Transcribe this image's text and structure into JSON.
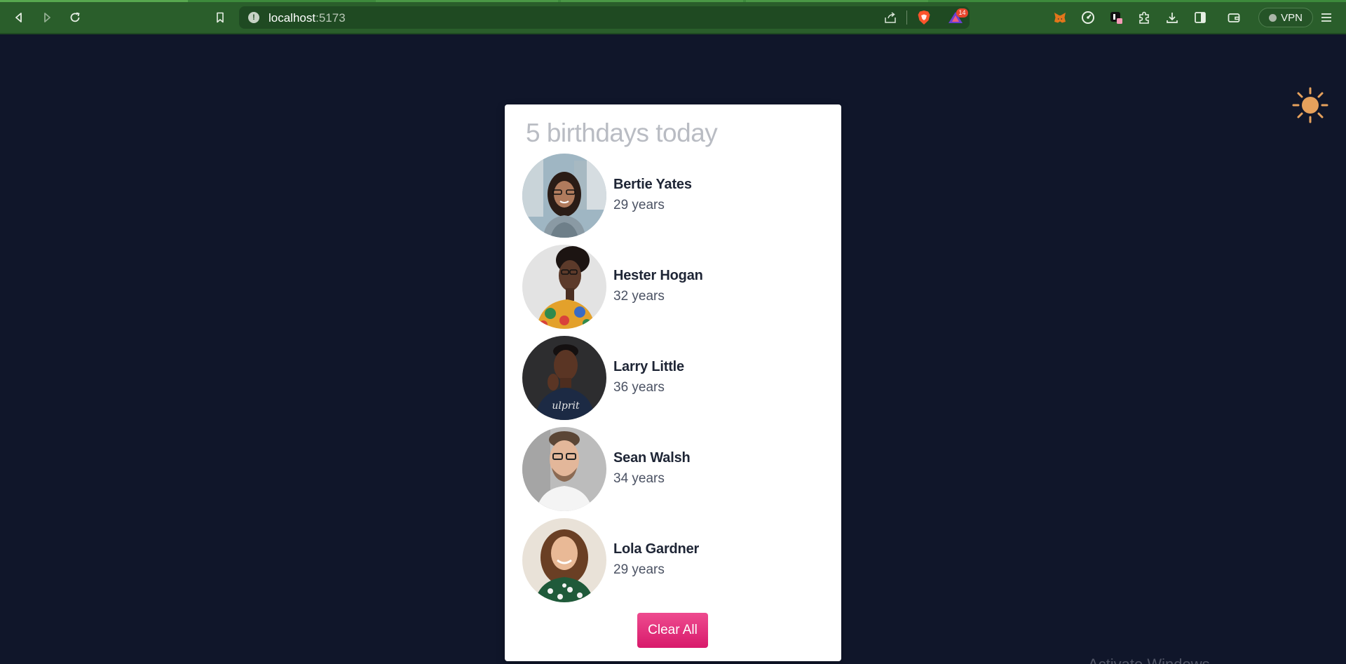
{
  "browser": {
    "url_host": "localhost",
    "url_port": ":5173",
    "rewards_badge": "14",
    "vpn_label": "VPN",
    "icons": [
      "back-icon",
      "forward-icon",
      "reload-icon",
      "bookmark-icon",
      "info-icon",
      "share-icon",
      "brave-shield-icon",
      "brave-rewards-icon",
      "metamask-icon",
      "speedometer-icon",
      "extension-dev-icon",
      "extensions-puzzle-icon",
      "download-icon",
      "sidebar-icon",
      "wallet-icon",
      "menu-icon"
    ]
  },
  "app": {
    "title": "5 birthdays today",
    "people": [
      {
        "name": "Bertie Yates",
        "age": "29 years"
      },
      {
        "name": "Hester Hogan",
        "age": "32 years"
      },
      {
        "name": "Larry Little",
        "age": "36 years"
      },
      {
        "name": "Sean Walsh",
        "age": "34 years"
      },
      {
        "name": "Lola Gardner",
        "age": "29 years"
      }
    ],
    "clear_button": "Clear All"
  },
  "colors": {
    "page_background": "#10162a",
    "card_background": "#ffffff",
    "button_pink": "#e0286f",
    "sun_orange": "#e6a15c",
    "browser_green": "#2a5e2b"
  },
  "watermark": "Activate Windows"
}
